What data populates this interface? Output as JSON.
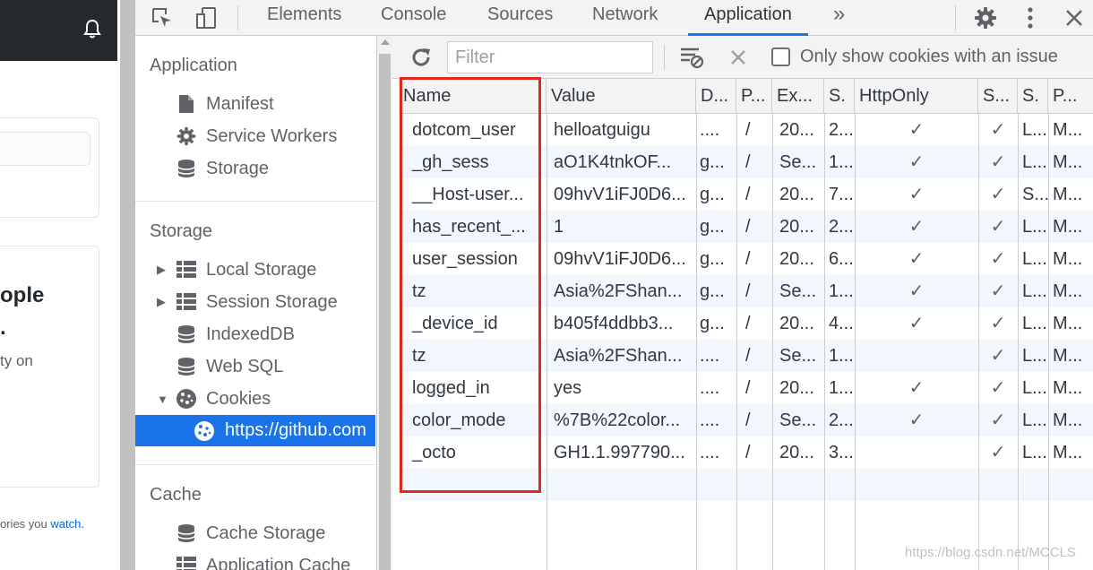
{
  "page_strip": {
    "big_text": "ople",
    "dot_text": ".",
    "small_text": "ty on",
    "footer_prefix": "ories you ",
    "footer_link": "watch."
  },
  "devtools": {
    "tabs": [
      {
        "label": "Elements"
      },
      {
        "label": "Console"
      },
      {
        "label": "Sources"
      },
      {
        "label": "Network"
      },
      {
        "label": "Application"
      }
    ],
    "active_tab": "Application",
    "more_tabs_glyph": "»"
  },
  "sidebar": {
    "sections": [
      {
        "title": "Application",
        "items": [
          {
            "label": "Manifest",
            "icon": "file-icon"
          },
          {
            "label": "Service Workers",
            "icon": "gear-icon"
          },
          {
            "label": "Storage",
            "icon": "database-icon"
          }
        ]
      },
      {
        "title": "Storage",
        "items": [
          {
            "label": "Local Storage",
            "icon": "grid-icon"
          },
          {
            "label": "Session Storage",
            "icon": "grid-icon"
          },
          {
            "label": "IndexedDB",
            "icon": "database-icon"
          },
          {
            "label": "Web SQL",
            "icon": "database-icon"
          },
          {
            "label": "Cookies",
            "icon": "cookie-icon"
          },
          {
            "label": "https://github.com",
            "icon": "cookie-icon"
          }
        ]
      },
      {
        "title": "Cache",
        "items": [
          {
            "label": "Cache Storage",
            "icon": "database-icon"
          },
          {
            "label": "Application Cache",
            "icon": "grid-icon"
          }
        ]
      }
    ]
  },
  "cookies": {
    "filter_placeholder": "Filter",
    "only_issue_label": "Only show cookies with an issue",
    "columns": [
      "Name",
      "Value",
      "D...",
      "P...",
      "Ex...",
      "S.",
      "HttpOnly",
      "S...",
      "S.",
      "P..."
    ],
    "check_glyph": "✓",
    "rows": [
      {
        "name": "dotcom_user",
        "value": "helloatguigu",
        "domain": "....",
        "path": "/",
        "expires": "20...",
        "size": "2...",
        "httponly": true,
        "secure": true,
        "samesite": "L...",
        "priority": "M..."
      },
      {
        "name": "_gh_sess",
        "value": "aO1K4tnkOF...",
        "domain": "g...",
        "path": "/",
        "expires": "Se...",
        "size": "1...",
        "httponly": true,
        "secure": true,
        "samesite": "L...",
        "priority": "M..."
      },
      {
        "name": "__Host-user...",
        "value": "09hvV1iFJ0D6...",
        "domain": "g...",
        "path": "/",
        "expires": "20...",
        "size": "7...",
        "httponly": true,
        "secure": true,
        "samesite": "S...",
        "priority": "M..."
      },
      {
        "name": "has_recent_...",
        "value": "1",
        "domain": "g...",
        "path": "/",
        "expires": "20...",
        "size": "2...",
        "httponly": true,
        "secure": true,
        "samesite": "L...",
        "priority": "M..."
      },
      {
        "name": "user_session",
        "value": "09hvV1iFJ0D6...",
        "domain": "g...",
        "path": "/",
        "expires": "20...",
        "size": "6...",
        "httponly": true,
        "secure": true,
        "samesite": "L...",
        "priority": "M..."
      },
      {
        "name": "tz",
        "value": "Asia%2FShan...",
        "domain": "g...",
        "path": "/",
        "expires": "Se...",
        "size": "1...",
        "httponly": true,
        "secure": true,
        "samesite": "L...",
        "priority": "M..."
      },
      {
        "name": "_device_id",
        "value": "b405f4ddbb3...",
        "domain": "g...",
        "path": "/",
        "expires": "20...",
        "size": "4...",
        "httponly": true,
        "secure": true,
        "samesite": "L...",
        "priority": "M..."
      },
      {
        "name": "tz",
        "value": "Asia%2FShan...",
        "domain": "....",
        "path": "/",
        "expires": "Se...",
        "size": "1...",
        "httponly": false,
        "secure": true,
        "samesite": "L...",
        "priority": "M..."
      },
      {
        "name": "logged_in",
        "value": "yes",
        "domain": "....",
        "path": "/",
        "expires": "20...",
        "size": "1...",
        "httponly": true,
        "secure": true,
        "samesite": "L...",
        "priority": "M..."
      },
      {
        "name": "color_mode",
        "value": "%7B%22color...",
        "domain": "....",
        "path": "/",
        "expires": "Se...",
        "size": "2...",
        "httponly": true,
        "secure": true,
        "samesite": "L...",
        "priority": "M..."
      },
      {
        "name": "_octo",
        "value": "GH1.1.997790...",
        "domain": "....",
        "path": "/",
        "expires": "20...",
        "size": "3...",
        "httponly": false,
        "secure": true,
        "samesite": "L...",
        "priority": "M..."
      }
    ]
  },
  "watermark": "https://blog.csdn.net/MCCLS",
  "colors": {
    "accent": "#1a73e8",
    "highlight": "#e0271a",
    "github_dark": "#24292e"
  }
}
